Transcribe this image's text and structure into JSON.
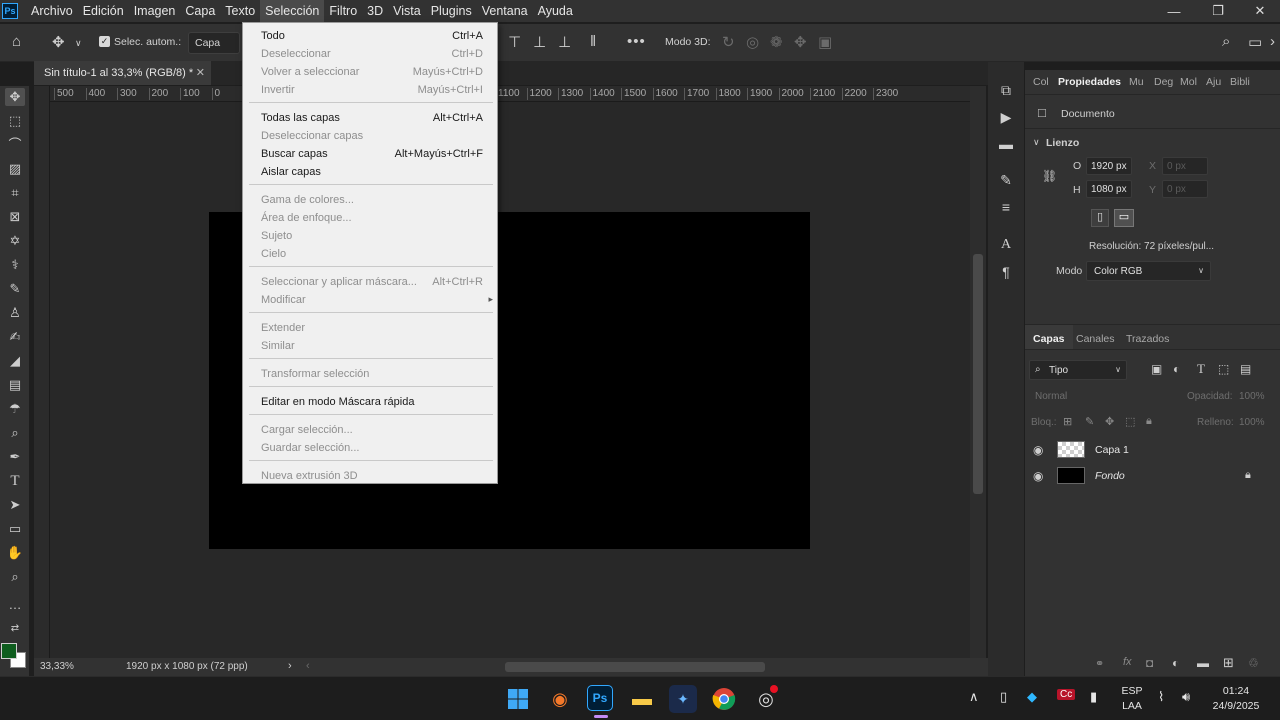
{
  "app": {
    "logo_text": "Ps",
    "menus": [
      "Archivo",
      "Edición",
      "Imagen",
      "Capa",
      "Texto",
      "Selección",
      "Filtro",
      "3D",
      "Vista",
      "Plugins",
      "Ventana",
      "Ayuda"
    ],
    "active_menu": "Selección"
  },
  "options_bar": {
    "auto_select_label": "Selec. autom.:",
    "auto_select_target": "Capa",
    "mode_3d_label": "Modo 3D:"
  },
  "document": {
    "tab_title": "Sin título-1 al 33,3% (RGB/8) *",
    "ruler_marks": [
      "500",
      "400",
      "300",
      "200",
      "100",
      "0",
      "",
      "",
      "",
      "",
      "",
      "",
      "",
      "",
      "1100",
      "1200",
      "1300",
      "1400",
      "1500",
      "1600",
      "1700",
      "1800",
      "1900",
      "2000",
      "2100",
      "2200",
      "2300"
    ],
    "zoom": "33,33%",
    "doc_info": "1920 px x 1080 px (72 ppp)"
  },
  "selection_menu": {
    "items": [
      {
        "label": "Todo",
        "shortcut": "Ctrl+A",
        "enabled": true
      },
      {
        "label": "Deseleccionar",
        "shortcut": "Ctrl+D",
        "enabled": false
      },
      {
        "label": "Volver a seleccionar",
        "shortcut": "Mayús+Ctrl+D",
        "enabled": false
      },
      {
        "label": "Invertir",
        "shortcut": "Mayús+Ctrl+I",
        "enabled": false
      },
      {
        "label": "Todas las capas",
        "shortcut": "Alt+Ctrl+A",
        "enabled": true
      },
      {
        "label": "Deseleccionar capas",
        "shortcut": "",
        "enabled": false
      },
      {
        "label": "Buscar capas",
        "shortcut": "Alt+Mayús+Ctrl+F",
        "enabled": true
      },
      {
        "label": "Aislar capas",
        "shortcut": "",
        "enabled": true
      },
      {
        "label": "Gama de colores...",
        "shortcut": "",
        "enabled": false
      },
      {
        "label": "Área de enfoque...",
        "shortcut": "",
        "enabled": false
      },
      {
        "label": "Sujeto",
        "shortcut": "",
        "enabled": false
      },
      {
        "label": "Cielo",
        "shortcut": "",
        "enabled": false
      },
      {
        "label": "Seleccionar y aplicar máscara...",
        "shortcut": "Alt+Ctrl+R",
        "enabled": false
      },
      {
        "label": "Modificar",
        "shortcut": "",
        "enabled": false,
        "submenu": true
      },
      {
        "label": "Extender",
        "shortcut": "",
        "enabled": false
      },
      {
        "label": "Similar",
        "shortcut": "",
        "enabled": false
      },
      {
        "label": "Transformar selección",
        "shortcut": "",
        "enabled": false
      },
      {
        "label": "Editar en modo Máscara rápida",
        "shortcut": "",
        "enabled": true
      },
      {
        "label": "Cargar selección...",
        "shortcut": "",
        "enabled": false
      },
      {
        "label": "Guardar selección...",
        "shortcut": "",
        "enabled": false
      },
      {
        "label": "Nueva extrusión 3D",
        "shortcut": "",
        "enabled": false
      }
    ]
  },
  "properties_panel": {
    "tabs": [
      "Col",
      "Propiedades",
      "Mu",
      "Deg",
      "Mol",
      "Aju",
      "Bibli"
    ],
    "active_tab": "Propiedades",
    "section_doc": "Documento",
    "section_canvas": "Lienzo",
    "width_label": "O",
    "width_value": "1920 px",
    "height_label": "H",
    "height_value": "1080 px",
    "x_label": "X",
    "x_placeholder": "0 px",
    "y_label": "Y",
    "y_placeholder": "0 px",
    "resolution": "Resolución: 72 píxeles/pul...",
    "mode_label": "Modo",
    "mode_value": "Color RGB"
  },
  "layers_panel": {
    "tabs": [
      "Capas",
      "Canales",
      "Trazados"
    ],
    "active_tab": "Capas",
    "filter_value": "Tipo",
    "blend_mode": "Normal",
    "opacity_label": "Opacidad:",
    "opacity_value": "100%",
    "lock_label": "Bloq.:",
    "fill_label": "Relleno:",
    "fill_value": "100%",
    "layers": [
      {
        "name": "Capa 1",
        "italic": false
      },
      {
        "name": "Fondo",
        "italic": true
      }
    ]
  },
  "taskbar": {
    "lang_top": "ESP",
    "lang_bottom": "LAA",
    "time": "01:24",
    "date": "24/9/2025"
  },
  "colors": {
    "foreground": "#0e5d1e",
    "background": "#ffffff",
    "ps_accent": "#31a8ff"
  }
}
